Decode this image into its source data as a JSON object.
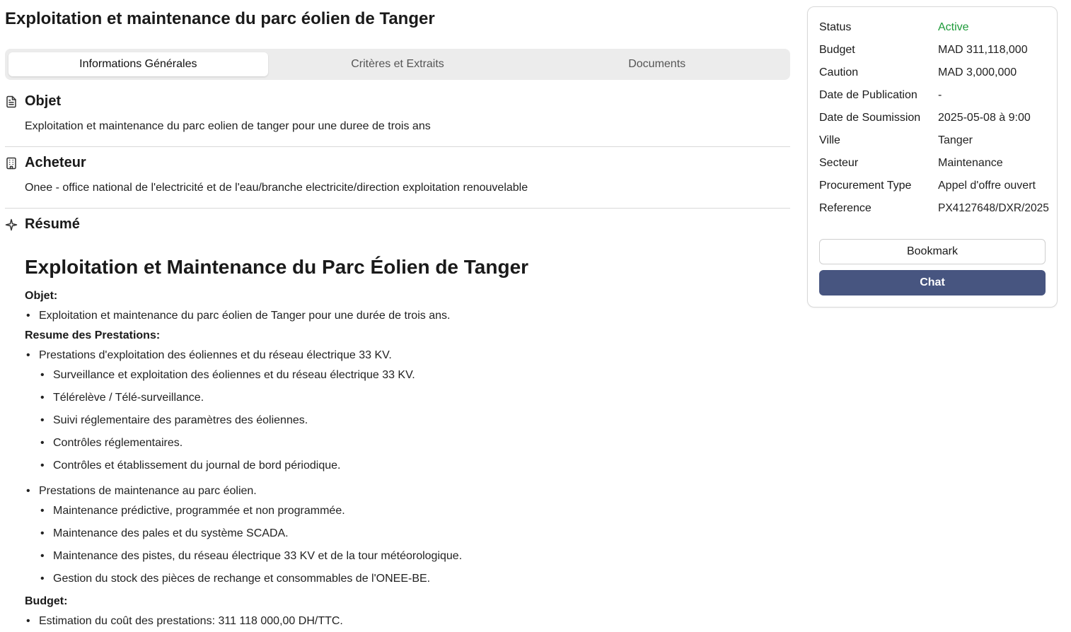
{
  "title": "Exploitation et maintenance du parc éolien de Tanger",
  "tabs": [
    {
      "label": "Informations Générales"
    },
    {
      "label": "Critères et Extraits"
    },
    {
      "label": "Documents"
    }
  ],
  "objet": {
    "heading": "Objet",
    "text": "Exploitation et maintenance du parc eolien de tanger pour une duree de trois ans"
  },
  "acheteur": {
    "heading": "Acheteur",
    "text": "Onee - office national de l'electricité et de l'eau/branche electricite/direction exploitation renouvelable"
  },
  "resume": {
    "heading": "Résumé",
    "title": "Exploitation et Maintenance du Parc Éolien de Tanger",
    "objet_label": "Objet:",
    "objet_item": "Exploitation et maintenance du parc éolien de Tanger pour une durée de trois ans.",
    "prestations_label": "Resume des Prestations:",
    "exploitation": "Prestations d'exploitation des éoliennes et du réseau électrique 33 KV.",
    "exploitation_items": [
      "Surveillance et exploitation des éoliennes et du réseau électrique 33 KV.",
      "Télérelève / Télé-surveillance.",
      "Suivi réglementaire des paramètres des éoliennes.",
      "Contrôles réglementaires.",
      "Contrôles et établissement du journal de bord périodique."
    ],
    "maintenance": "Prestations de maintenance au parc éolien.",
    "maintenance_items": [
      "Maintenance prédictive, programmée et non programmée.",
      "Maintenance des pales et du système SCADA.",
      "Maintenance des pistes, du réseau électrique 33 KV et de la tour météorologique.",
      "Gestion du stock des pièces de rechange et consommables de l'ONEE-BE."
    ],
    "budget_label": "Budget:",
    "budget_item": "Estimation du coût des prestations: 311 118 000,00 DH/TTC."
  },
  "sidebar": {
    "rows": [
      {
        "label": "Status",
        "value": "Active"
      },
      {
        "label": "Budget",
        "value": "MAD 311,118,000"
      },
      {
        "label": "Caution",
        "value": "MAD 3,000,000"
      },
      {
        "label": "Date de Publication",
        "value": "-"
      },
      {
        "label": "Date de Soumission",
        "value": "2025-05-08 à 9:00"
      },
      {
        "label": "Ville",
        "value": "Tanger"
      },
      {
        "label": "Secteur",
        "value": "Maintenance"
      },
      {
        "label": "Procurement Type",
        "value": "Appel d'offre ouvert"
      },
      {
        "label": "Reference",
        "value": "PX4127648/DXR/2025"
      }
    ],
    "bookmark_label": "Bookmark",
    "chat_label": "Chat"
  },
  "colors": {
    "status_active": "#1e9b3a",
    "chat_button": "#475580"
  }
}
